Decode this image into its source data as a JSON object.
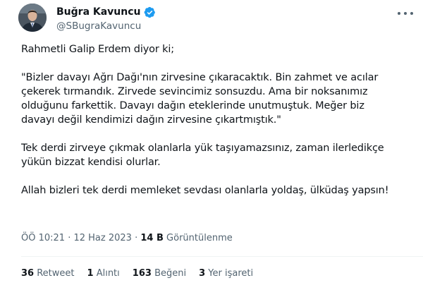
{
  "user": {
    "display_name": "Buğra Kavuncu",
    "handle": "@SBugraKavuncu",
    "verified_icon": "verified-badge-icon",
    "accent_color": "#1d9bf0"
  },
  "tweet": {
    "lines": [
      "Rahmetli Galip Erdem diyor ki;",
      "",
      "\"Bizler davayı Ağrı Dağı'nın zirvesine çıkaracaktık. Bin zahmet ve acılar",
      "çekerek tırmandık. Zirvede sevincimiz sonsuzdu. Ama bir noksanımız",
      "olduğunu farkettik. Davayı dağın eteklerinde unutmuştuk. Meğer biz",
      "davayı değil kendimizi dağın zirvesine çıkartmıştık.\"",
      "",
      "Tek derdi zirveye çıkmak olanlarla yük taşıyamazsınız, zaman ilerledikçe",
      "yükün bizzat kendisi olurlar.",
      "",
      "Allah bizleri tek derdi memleket sevdası olanlarla yoldaş, ülküdaş yapsın!"
    ]
  },
  "meta": {
    "time": "ÖÖ 10:21",
    "separator": "·",
    "date": "12 Haz 2023",
    "views_count": "14 B",
    "views_label": "Görüntülenme"
  },
  "stats": {
    "retweets_count": "36",
    "retweets_label": "Retweet",
    "quotes_count": "1",
    "quotes_label": "Alıntı",
    "likes_count": "163",
    "likes_label": "Beğeni",
    "bookmarks_count": "3",
    "bookmarks_label": "Yer işareti"
  }
}
